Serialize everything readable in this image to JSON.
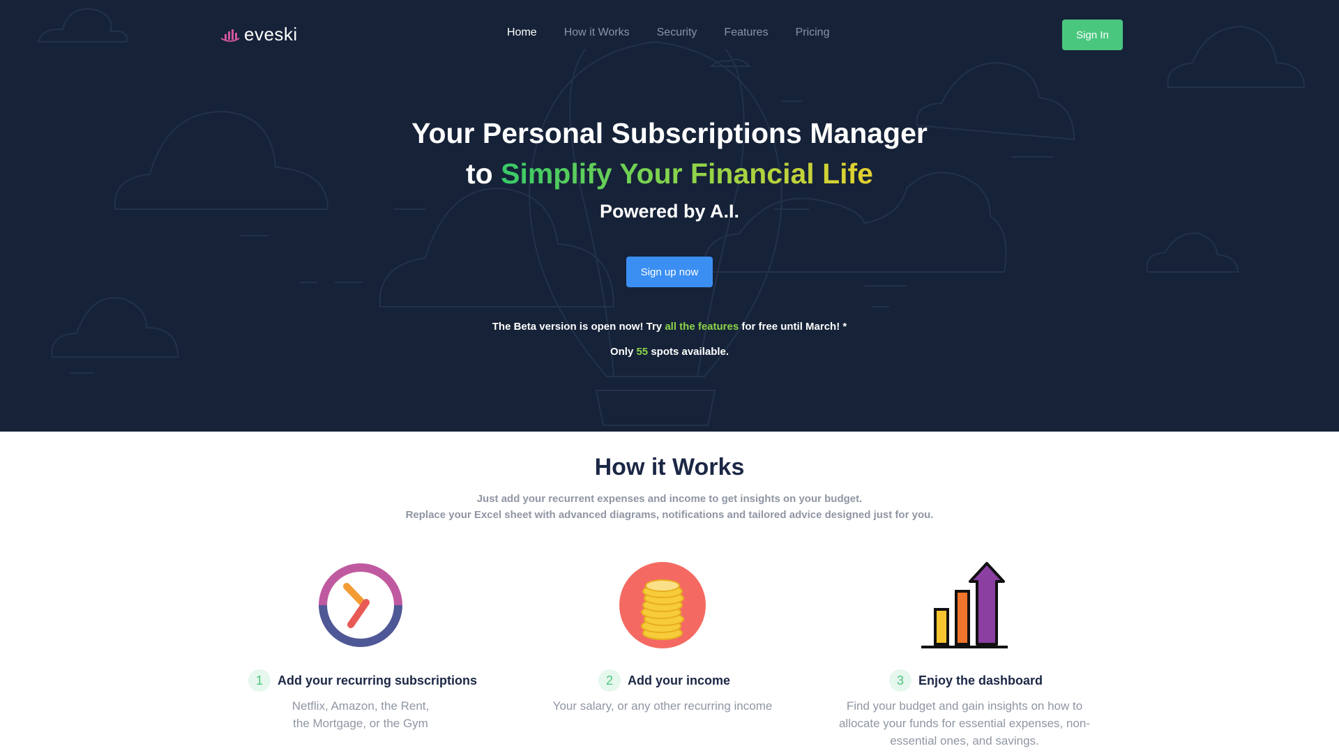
{
  "brand": {
    "name": "eveski",
    "logo_icon": "bar-chart-logo-icon",
    "logo_color": "#d0569a"
  },
  "nav": {
    "links": [
      "Home",
      "How it Works",
      "Security",
      "Features",
      "Pricing"
    ],
    "active": "Home",
    "sign_in_label": "Sign In"
  },
  "hero": {
    "title_line1": "Your Personal Subscriptions Manager",
    "title_line2_prefix": "to ",
    "title_line2_highlight": "Simplify Your Financial Life",
    "subtitle": "Powered by A.I.",
    "cta_label": "Sign up now",
    "beta_prefix": "The Beta version is open now! Try ",
    "beta_highlight": "all the features",
    "beta_suffix": " for free until March! *",
    "spots_prefix": "Only ",
    "spots_count": "55",
    "spots_suffix": " spots available."
  },
  "how": {
    "title": "How it Works",
    "subtitle_line1": "Just add your recurrent expenses and income to get insights on your budget.",
    "subtitle_line2": "Replace your Excel sheet with advanced diagrams, notifications and tailored advice designed just for you.",
    "steps": [
      {
        "number": "1",
        "title": "Add your recurring subscriptions",
        "desc_line1": "Netflix, Amazon, the Rent,",
        "desc_line2": "the Mortgage, or the Gym",
        "icon": "clock-icon"
      },
      {
        "number": "2",
        "title": "Add your income",
        "desc_line1": "Your salary, or any other recurring income",
        "desc_line2": "",
        "icon": "coins-icon"
      },
      {
        "number": "3",
        "title": "Enjoy the dashboard",
        "desc_line1": "Find your budget and gain insights on how to",
        "desc_line2": "allocate your funds for essential expenses, non-",
        "desc_line3": "essential ones, and savings.",
        "icon": "growth-chart-icon"
      }
    ]
  },
  "colors": {
    "hero_bg": "#162238",
    "accent_green": "#4ac77f",
    "cta_blue": "#3b8ff2",
    "heading_dark": "#1b2745"
  }
}
